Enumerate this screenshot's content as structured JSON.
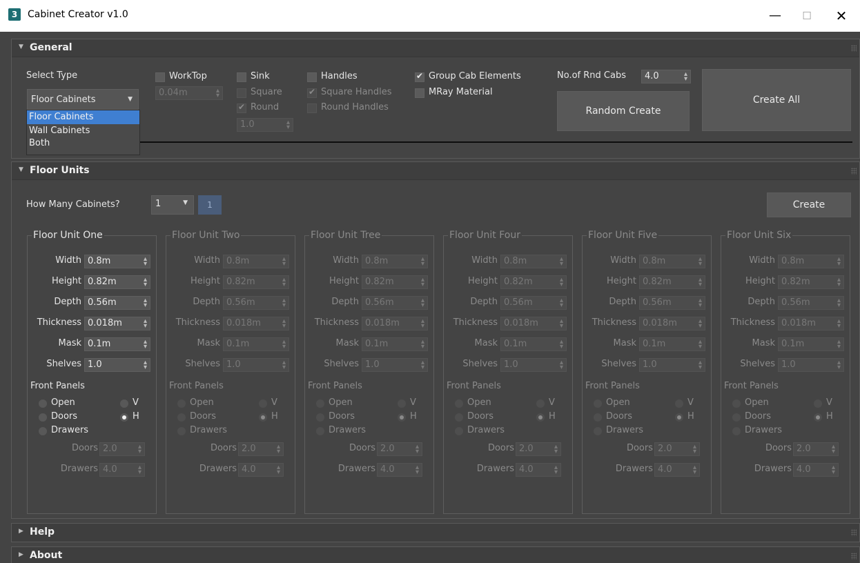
{
  "window": {
    "icon_label": "3",
    "title": "Cabinet Creator v1.0",
    "minimize": "—",
    "maximize": "☐",
    "close": "✕"
  },
  "icons": {
    "minimize": "minimize-icon",
    "maximize": "maximize-icon",
    "close": "close-icon",
    "expanded": "triangle-down-icon",
    "collapsed": "triangle-right-icon"
  },
  "general": {
    "title": "General",
    "select_type_label": "Select Type",
    "select_type_value": "Floor Cabinets",
    "select_type_options": [
      "Floor Cabinets",
      "Wall Cabinets",
      "Both"
    ],
    "worktop": {
      "label": "WorkTop",
      "value": "0.04m"
    },
    "sink": {
      "label": "Sink",
      "square": "Square",
      "round": "Round",
      "value": "1.0"
    },
    "handles": {
      "label": "Handles",
      "square": "Square Handles",
      "round": "Round Handles"
    },
    "group_cab": "Group Cab Elements",
    "mray": "MRay Material",
    "rnd_cabs": {
      "label": "No.of Rnd Cabs",
      "value": "4.0"
    },
    "random_create": "Random Create",
    "create_all": "Create All"
  },
  "floor_units": {
    "title": "Floor Units",
    "how_many_label": "How Many Cabinets?",
    "how_many_value": "1",
    "count_badge": "1",
    "create": "Create",
    "field_labels": {
      "width": "Width",
      "height": "Height",
      "depth": "Depth",
      "thickness": "Thickness",
      "mask": "Mask",
      "shelves": "Shelves"
    },
    "front_panels_label": "Front Panels",
    "radio_labels": {
      "open": "Open",
      "doors": "Doors",
      "drawers": "Drawers",
      "v": "V",
      "h": "H"
    },
    "doors_label": "Doors",
    "drawers_label": "Drawers",
    "units": [
      {
        "name": "Floor Unit One",
        "width": "0.8m",
        "height": "0.82m",
        "depth": "0.56m",
        "thickness": "0.018m",
        "mask": "0.1m",
        "shelves": "1.0",
        "doors": "2.0",
        "drawers": "4.0"
      },
      {
        "name": "Floor Unit Two",
        "width": "0.8m",
        "height": "0.82m",
        "depth": "0.56m",
        "thickness": "0.018m",
        "mask": "0.1m",
        "shelves": "1.0",
        "doors": "2.0",
        "drawers": "4.0"
      },
      {
        "name": "Floor Unit Tree",
        "width": "0.8m",
        "height": "0.82m",
        "depth": "0.56m",
        "thickness": "0.018m",
        "mask": "0.1m",
        "shelves": "1.0",
        "doors": "2.0",
        "drawers": "4.0"
      },
      {
        "name": "Floor Unit Four",
        "width": "0.8m",
        "height": "0.82m",
        "depth": "0.56m",
        "thickness": "0.018m",
        "mask": "0.1m",
        "shelves": "1.0",
        "doors": "2.0",
        "drawers": "4.0"
      },
      {
        "name": "Floor Unit Five",
        "width": "0.8m",
        "height": "0.82m",
        "depth": "0.56m",
        "thickness": "0.018m",
        "mask": "0.1m",
        "shelves": "1.0",
        "doors": "2.0",
        "drawers": "4.0"
      },
      {
        "name": "Floor Unit Six",
        "width": "0.8m",
        "height": "0.82m",
        "depth": "0.56m",
        "thickness": "0.018m",
        "mask": "0.1m",
        "shelves": "1.0",
        "doors": "2.0",
        "drawers": "4.0"
      }
    ]
  },
  "help": {
    "title": "Help"
  },
  "about": {
    "title": "About"
  },
  "colors": {
    "background": "#444444",
    "header": "#3e3e3e",
    "selection": "#3f7fd1",
    "text": "#e6e6e6",
    "disabled_text": "#8a8a8a"
  }
}
